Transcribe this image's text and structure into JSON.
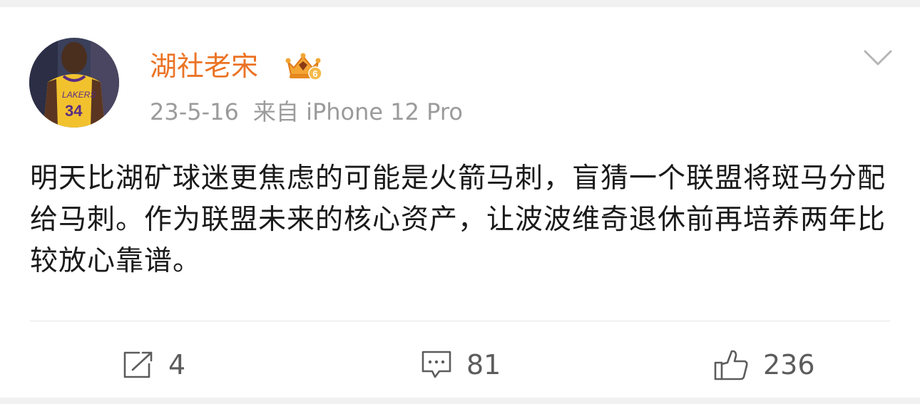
{
  "post": {
    "username": "湖社老宋",
    "timestamp": "23-5-16",
    "source": "来自 iPhone 12 Pro",
    "content": "明天比湖矿球迷更焦虑的可能是火箭马刺，盲猜一个联盟将斑马分配给马刺。作为联盟未来的核心资产，让波波维奇退休前再培养两年比较放心靠谱。",
    "more_icon": "chevron-down-icon",
    "badge_icon": "vip-crown-icon",
    "badge_level": "6"
  },
  "actions": {
    "repost": {
      "icon": "repost-icon",
      "count": "4"
    },
    "comment": {
      "icon": "comment-icon",
      "count": "81"
    },
    "like": {
      "icon": "thumbs-up-icon",
      "count": "236"
    }
  },
  "colors": {
    "username": "#eb7325",
    "meta": "#9b9b9b",
    "text": "#1a1a1a",
    "action": "#5c5c5c",
    "background": "#f1f1f1",
    "card": "#ffffff"
  }
}
